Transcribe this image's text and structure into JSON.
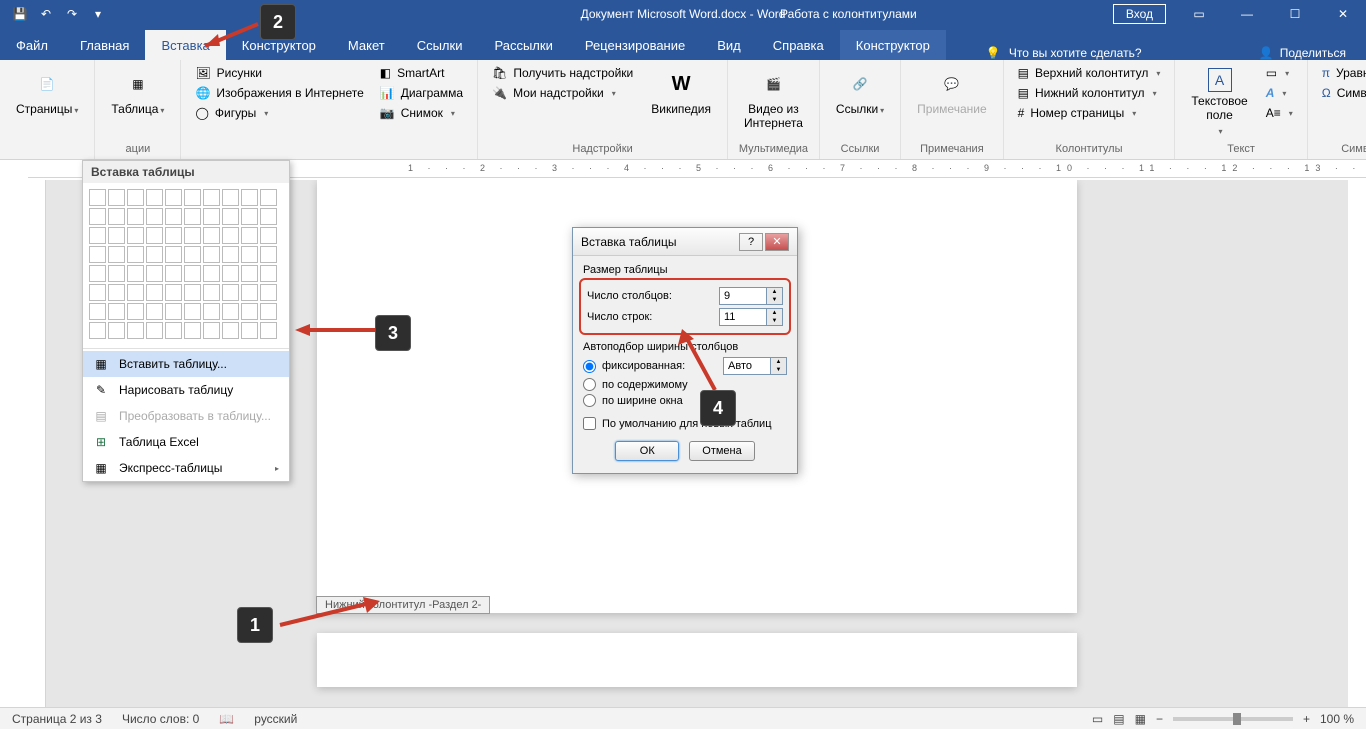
{
  "titlebar": {
    "doc_title": "Документ Microsoft Word.docx - Word",
    "contextual": "Работа с колонтитулами",
    "login": "Вход"
  },
  "tabs": {
    "file": "Файл",
    "home": "Главная",
    "insert": "Вставка",
    "design": "Конструктор",
    "layout": "Макет",
    "references": "Ссылки",
    "mailings": "Рассылки",
    "review": "Рецензирование",
    "view": "Вид",
    "help": "Справка",
    "contextual_design": "Конструктор",
    "tell_me": "Что вы хотите сделать?",
    "share": "Поделиться"
  },
  "ribbon": {
    "pages": {
      "label": "Страницы",
      "btn": "Страницы"
    },
    "tables": {
      "label": "ации",
      "btn": "Таблица"
    },
    "illustrations": {
      "pictures": "Рисунки",
      "online_pictures": "Изображения в Интернете",
      "shapes": "Фигуры",
      "smartart": "SmartArt",
      "chart": "Диаграмма",
      "screenshot": "Снимок"
    },
    "addins": {
      "label": "Надстройки",
      "get": "Получить надстройки",
      "my": "Мои надстройки",
      "wiki": "Википедия"
    },
    "media": {
      "label": "Мультимедиа",
      "video": "Видео из Интернета"
    },
    "links": {
      "label": "Ссылки",
      "btn": "Ссылки"
    },
    "comments": {
      "label": "Примечания",
      "btn": "Примечание"
    },
    "headerfooter": {
      "label": "Колонтитулы",
      "header": "Верхний колонтитул",
      "footer": "Нижний колонтитул",
      "pagenum": "Номер страницы"
    },
    "text": {
      "label": "Текст",
      "textbox": "Текстовое поле"
    },
    "symbols": {
      "label": "Символы",
      "equation": "Уравнение",
      "symbol": "Символ"
    }
  },
  "dropdown": {
    "title": "Вставка таблицы",
    "insert_table": "Вставить таблицу...",
    "draw_table": "Нарисовать таблицу",
    "convert": "Преобразовать в таблицу...",
    "excel": "Таблица Excel",
    "quick": "Экспресс-таблицы"
  },
  "dialog": {
    "title": "Вставка таблицы",
    "size_label": "Размер таблицы",
    "cols_label": "Число столбцов:",
    "cols_value": "9",
    "rows_label": "Число строк:",
    "rows_value": "11",
    "autofit_label": "Автоподбор ширины столбцов",
    "fixed": "фиксированная:",
    "fixed_value": "Авто",
    "by_content": "по содержимому",
    "by_window": "по ширине окна",
    "remember": "По умолчанию для новых таблиц",
    "ok": "ОК",
    "cancel": "Отмена"
  },
  "page": {
    "footer_tab": "Нижний колонтитул -Раздел 2-"
  },
  "status": {
    "page": "Страница 2 из 3",
    "words": "Число слов: 0",
    "lang": "русский",
    "zoom": "100 %"
  },
  "callouts": {
    "c1": "1",
    "c2": "2",
    "c3": "3",
    "c4": "4"
  }
}
